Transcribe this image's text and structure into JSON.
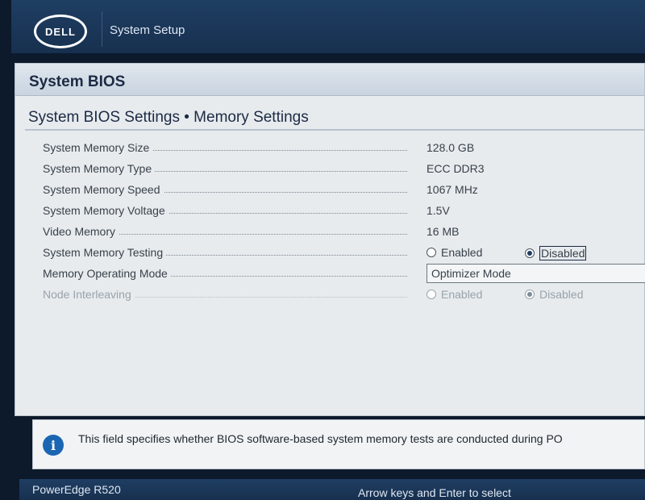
{
  "header": {
    "logo_text": "DELL",
    "title": "System Setup"
  },
  "section": {
    "title": "System BIOS"
  },
  "page": {
    "title": "System BIOS Settings • Memory Settings"
  },
  "settings": [
    {
      "label": "System Memory Size",
      "value": "128.0 GB"
    },
    {
      "label": "System Memory Type",
      "value": "ECC DDR3"
    },
    {
      "label": "System Memory Speed",
      "value": "1067 MHz"
    },
    {
      "label": "System Memory Voltage",
      "value": "1.5V"
    },
    {
      "label": "Video Memory",
      "value": "16 MB"
    },
    {
      "label": "System Memory Testing",
      "options": [
        "Enabled",
        "Disabled"
      ],
      "selected": "Disabled"
    },
    {
      "label": "Memory Operating Mode",
      "value": "Optimizer Mode"
    },
    {
      "label": "Node Interleaving",
      "options": [
        "Enabled",
        "Disabled"
      ],
      "selected": "Disabled",
      "disabled": true
    }
  ],
  "help": {
    "icon": "info-icon",
    "text": "This field specifies whether BIOS software-based system memory tests are conducted during PO"
  },
  "footer": {
    "model": "PowerEdge R520",
    "hint": "Arrow keys and Enter to select"
  },
  "colors": {
    "header_bg": "#1f3e63",
    "panel_bg": "#e7ebee",
    "info_icon": "#1b66b3"
  }
}
